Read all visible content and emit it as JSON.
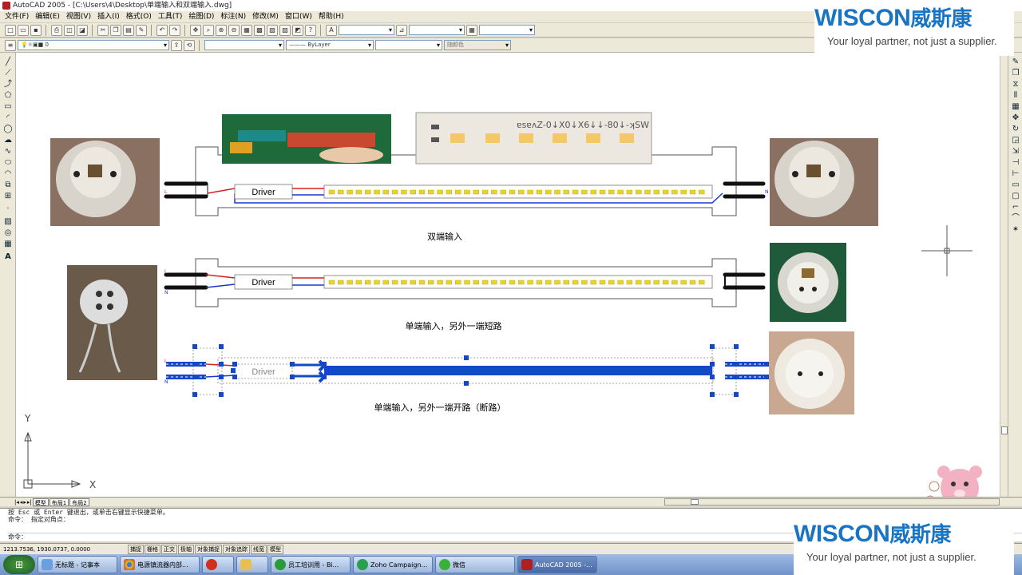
{
  "window": {
    "title": "AutoCAD 2005 - [C:\\Users\\4\\Desktop\\单端输入和双端输入.dwg]"
  },
  "menu": [
    "文件(F)",
    "编辑(E)",
    "视图(V)",
    "插入(I)",
    "格式(O)",
    "工具(T)",
    "绘图(D)",
    "标注(N)",
    "修改(M)",
    "窗口(W)",
    "帮助(H)"
  ],
  "properties_bar": {
    "layer": "0",
    "linetype": "ByLayer",
    "color": "随颜色"
  },
  "diagram": {
    "driver_label": "Driver",
    "captions": [
      "双端输入",
      "单端输入，另外一端短路",
      "单端输入，另外一端开路（断路）"
    ],
    "pin_labels": {
      "L": "L",
      "N": "N"
    },
    "strip_text": "ɐsɐʌZ-0↓X0↓X6↓↓-80↓-ʞSW"
  },
  "ucs": {
    "x": "X",
    "y": "Y"
  },
  "tabs": [
    "模型",
    "布局1",
    "布局2"
  ],
  "command": {
    "lines": [
      "按 Esc 或 Enter 键退出，或单击右键显示快捷菜单。",
      "命令： 指定对角点：",
      "命令："
    ]
  },
  "status": {
    "coords": "1213.7536, 1930.0737, 0.0000",
    "toggles": [
      "捕捉",
      "栅格",
      "正交",
      "极轴",
      "对象捕捉",
      "对象追踪",
      "线宽",
      "模型"
    ]
  },
  "taskbar": {
    "items": [
      "无标题 - 记事本",
      "电源镇流器内部...",
      "",
      "",
      "员工培训用 - Bi...",
      "Zoho Campaign...",
      "微信",
      "AutoCAD 2005 -..."
    ]
  },
  "watermark": {
    "brand": "WISCON",
    "brand_cn": "威斯康",
    "tagline": "Your loyal partner, not just a supplier."
  },
  "colors": {
    "accent_red": "#d42020",
    "accent_blue": "#1c36c8",
    "led_yellow": "#e8d428",
    "select_blue": "#1448c8",
    "brand_blue": "#1a74c4"
  }
}
